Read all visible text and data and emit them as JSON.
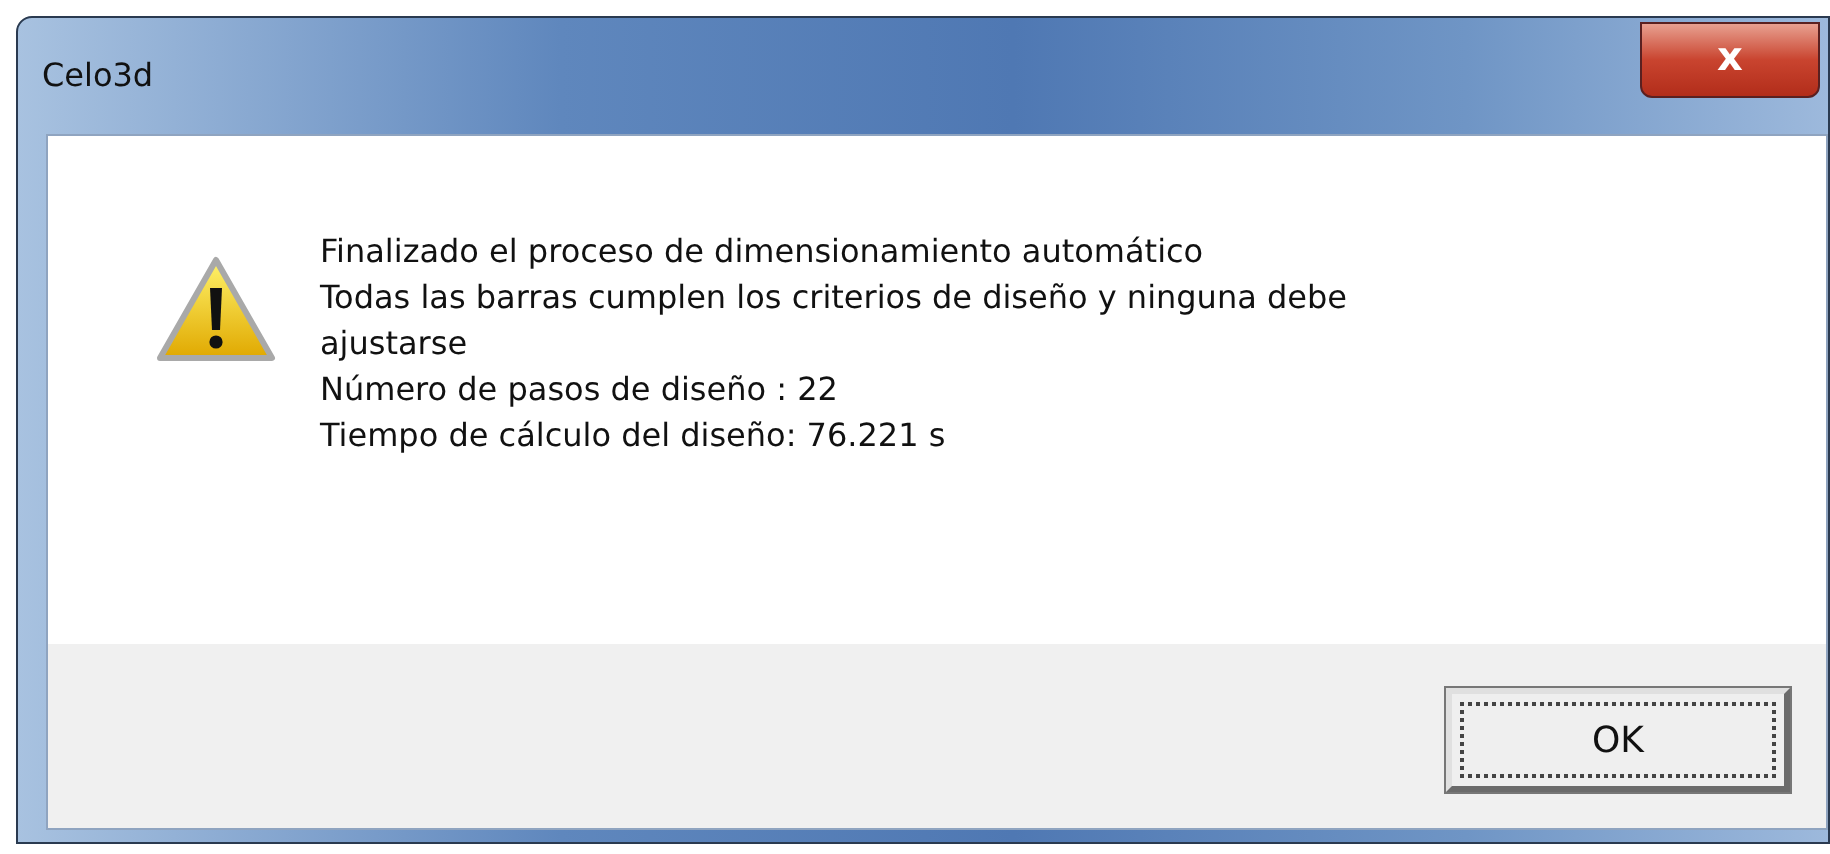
{
  "window": {
    "title": "Celo3d",
    "close": "x"
  },
  "message": {
    "kind": "warning",
    "lines": [
      "Finalizado el proceso de dimensionamiento automático",
      "Todas las barras cumplen los criterios de diseño y ninguna debe ajustarse",
      "Número de pasos de diseño : 22",
      "Tiempo de cálculo del diseño: 76.221 s"
    ]
  },
  "buttons": [
    {
      "label": "OK",
      "focused": true
    }
  ]
}
